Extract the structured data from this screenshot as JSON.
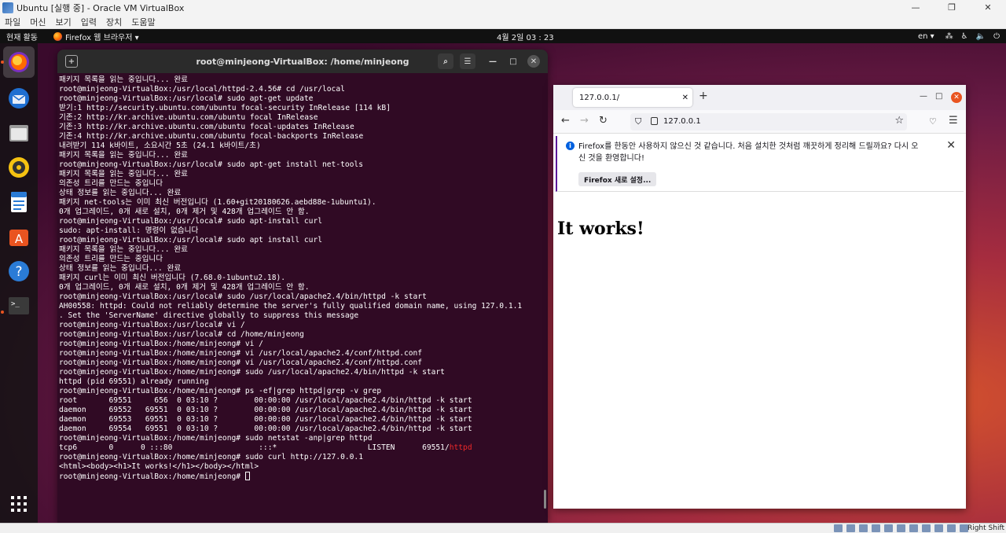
{
  "vbox": {
    "title": "Ubuntu [실행 중] - Oracle VM VirtualBox",
    "menu": [
      "파일",
      "머신",
      "보기",
      "입력",
      "장치",
      "도움말"
    ],
    "status_host_key": "Right Shift"
  },
  "topbar": {
    "activities": "현재 활동",
    "app_menu": "Firefox 웹 브라우저 ▾",
    "clock": "4월 2일  03 : 23",
    "lang": "en ▾"
  },
  "dock": {
    "items": [
      "firefox",
      "thunderbird",
      "files",
      "rhythmbox",
      "libreoffice-writer",
      "ubuntu-software",
      "help",
      "terminal",
      "show-apps"
    ]
  },
  "terminal": {
    "title": "root@minjeong-VirtualBox: /home/minjeong",
    "lines": [
      "패키지 목록을 읽는 중입니다... 완료",
      "root@minjeong-VirtualBox:/usr/local/httpd-2.4.56# cd /usr/local",
      "root@minjeong-VirtualBox:/usr/local# sudo apt-get update",
      "받기:1 http://security.ubuntu.com/ubuntu focal-security InRelease [114 kB]",
      "기존:2 http://kr.archive.ubuntu.com/ubuntu focal InRelease",
      "기존:3 http://kr.archive.ubuntu.com/ubuntu focal-updates InRelease",
      "기존:4 http://kr.archive.ubuntu.com/ubuntu focal-backports InRelease",
      "내려받기 114 k바이트, 소요시간 5초 (24.1 k바이트/초)",
      "패키지 목록을 읽는 중입니다... 완료",
      "root@minjeong-VirtualBox:/usr/local# sudo apt-get install net-tools",
      "패키지 목록을 읽는 중입니다... 완료",
      "의존성 트리를 만드는 중입니다",
      "상태 정보를 읽는 중입니다... 완료",
      "패키지 net-tools는 이미 최신 버전입니다 (1.60+git20180626.aebd88e-1ubuntu1).",
      "0개 업그레이드, 0개 새로 설치, 0개 제거 및 428개 업그레이드 안 함.",
      "root@minjeong-VirtualBox:/usr/local# sudo apt-install curl",
      "sudo: apt-install: 명령이 없습니다",
      "root@minjeong-VirtualBox:/usr/local# sudo apt install curl",
      "패키지 목록을 읽는 중입니다... 완료",
      "의존성 트리를 만드는 중입니다",
      "상태 정보를 읽는 중입니다... 완료",
      "패키지 curl는 이미 최신 버전입니다 (7.68.0-1ubuntu2.18).",
      "0개 업그레이드, 0개 새로 설치, 0개 제거 및 428개 업그레이드 안 함.",
      "root@minjeong-VirtualBox:/usr/local# sudo /usr/local/apache2.4/bin/httpd -k start",
      "AH00558: httpd: Could not reliably determine the server's fully qualified domain name, using 127.0.1.1",
      ". Set the 'ServerName' directive globally to suppress this message",
      "root@minjeong-VirtualBox:/usr/local# vi /",
      "root@minjeong-VirtualBox:/usr/local# cd /home/minjeong",
      "root@minjeong-VirtualBox:/home/minjeong# vi /",
      "root@minjeong-VirtualBox:/home/minjeong# vi /usr/local/apache2.4/conf/httpd.conf",
      "root@minjeong-VirtualBox:/home/minjeong# vi /usr/local/apache2.4/conf/httpd.conf",
      "root@minjeong-VirtualBox:/home/minjeong# sudo /usr/local/apache2.4/bin/httpd -k start",
      "httpd (pid 69551) already running",
      "root@minjeong-VirtualBox:/home/minjeong# ps -ef|grep httpd|grep -v grep",
      "root       69551     656  0 03:10 ?        00:00:00 /usr/local/apache2.4/bin/httpd -k start",
      "daemon     69552   69551  0 03:10 ?        00:00:00 /usr/local/apache2.4/bin/httpd -k start",
      "daemon     69553   69551  0 03:10 ?        00:00:00 /usr/local/apache2.4/bin/httpd -k start",
      "daemon     69554   69551  0 03:10 ?        00:00:00 /usr/local/apache2.4/bin/httpd -k start",
      "root@minjeong-VirtualBox:/home/minjeong# sudo netstat -anp|grep httpd",
      "tcp6       0      0 :::80                   :::*                    LISTEN      69551/",
      "root@minjeong-VirtualBox:/home/minjeong# sudo curl http://127.0.0.1",
      "<html><body><h1>It works!</h1></body></html>",
      "root@minjeong-VirtualBox:/home/minjeong# "
    ],
    "highlight_word": "httpd",
    "highlight_color": "#ef2929"
  },
  "firefox": {
    "tab_title": "127.0.0.1/",
    "url": "127.0.0.1",
    "notice_text": "Firefox를 한동안 사용하지 않으신 것 같습니다. 처음 설치한 것처럼 깨끗하게 정리해 드릴까요? 다시 오신 것을 환영합니다!",
    "notice_button": "Firefox 새로 설정...",
    "page_heading": "It works!"
  },
  "colors": {
    "terminal_bg": "#300a24",
    "ubuntu_orange": "#e95420"
  }
}
